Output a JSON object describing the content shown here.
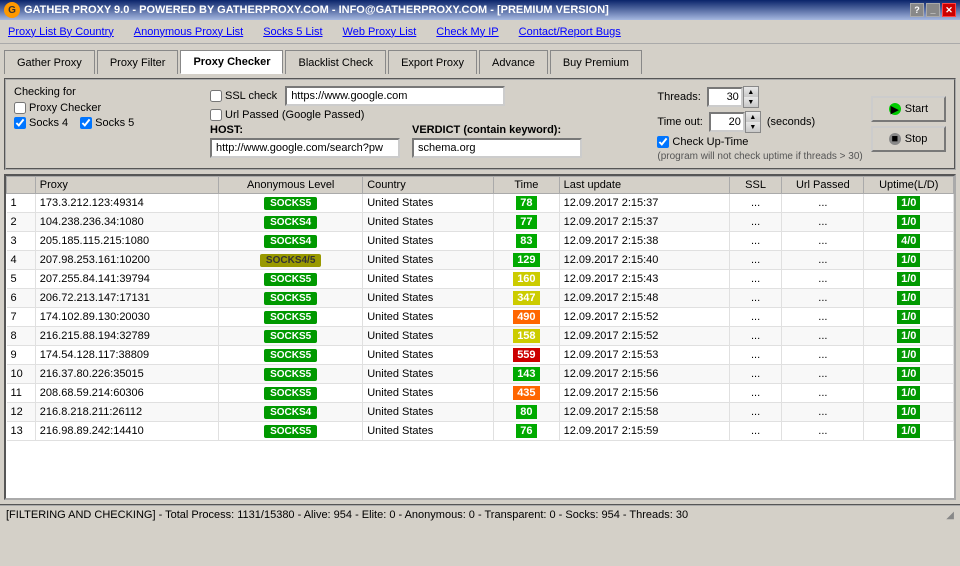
{
  "titlebar": {
    "logo": "G",
    "title": "GATHER PROXY 9.0 - POWERED BY GATHERPROXY.COM - INFO@GATHERPROXY.COM - [PREMIUM VERSION]",
    "help_btn": "?",
    "min_btn": "_",
    "close_btn": "✕"
  },
  "menubar": {
    "items": [
      {
        "id": "proxy-list-by-country",
        "label": "Proxy List By Country"
      },
      {
        "id": "anonymous-proxy-list",
        "label": "Anonymous Proxy List"
      },
      {
        "id": "socks5-list",
        "label": "Socks 5 List"
      },
      {
        "id": "web-proxy-list",
        "label": "Web Proxy List"
      },
      {
        "id": "check-my-ip",
        "label": "Check My IP"
      },
      {
        "id": "contact-report-bugs",
        "label": "Contact/Report Bugs"
      }
    ]
  },
  "tabs": [
    {
      "id": "gather-proxy",
      "label": "Gather Proxy",
      "active": false
    },
    {
      "id": "proxy-filter",
      "label": "Proxy Filter",
      "active": false
    },
    {
      "id": "proxy-checker",
      "label": "Proxy Checker",
      "active": true
    },
    {
      "id": "blacklist-check",
      "label": "Blacklist Check",
      "active": false
    },
    {
      "id": "export-proxy",
      "label": "Export Proxy",
      "active": false
    },
    {
      "id": "advance",
      "label": "Advance",
      "active": false
    },
    {
      "id": "buy-premium",
      "label": "Buy Premium",
      "active": false
    }
  ],
  "checking_panel": {
    "title": "Checking for",
    "proxy_checker_label": "Proxy Checker",
    "proxy_checker_checked": false,
    "socks4_label": "Socks 4",
    "socks4_checked": true,
    "socks5_label": "Socks 5",
    "socks5_checked": true,
    "ssl_check_label": "SSL check",
    "ssl_check_checked": false,
    "ssl_check_url": "https://www.google.com",
    "url_passed_label": "Url Passed (Google Passed)",
    "url_passed_checked": false,
    "host_label": "HOST:",
    "host_value": "http://www.google.com/search?pw",
    "verdict_label": "VERDICT (contain keyword):",
    "verdict_value": "schema.org",
    "threads_label": "Threads:",
    "threads_value": "30",
    "timeout_label": "Time out:",
    "timeout_value": "20",
    "timeout_unit": "(seconds)",
    "check_uptime_label": "Check Up-Time",
    "check_uptime_checked": true,
    "check_uptime_note": "(program will not check uptime if threads > 30)",
    "start_label": "Start",
    "stop_label": "Stop"
  },
  "table": {
    "columns": [
      "",
      "Proxy",
      "Anonymous Level",
      "Country",
      "Time",
      "Last update",
      "SSL",
      "Url Passed",
      "Uptime(L/D)"
    ],
    "rows": [
      {
        "num": "1",
        "proxy": "173.3.212.123:49314",
        "anon": "SOCKS5",
        "anon_class": "socks5",
        "country": "United States",
        "time": "78",
        "time_class": "time-green",
        "update": "12.09.2017 2:15:37",
        "ssl": "...",
        "url": "...",
        "uptime": "1/0",
        "uptime_class": "uptime-badge"
      },
      {
        "num": "2",
        "proxy": "104.238.236.34:1080",
        "anon": "SOCKS4",
        "anon_class": "socks4",
        "country": "United States",
        "time": "77",
        "time_class": "time-green",
        "update": "12.09.2017 2:15:37",
        "ssl": "...",
        "url": "...",
        "uptime": "1/0",
        "uptime_class": "uptime-badge"
      },
      {
        "num": "3",
        "proxy": "205.185.115.215:1080",
        "anon": "SOCKS4",
        "anon_class": "socks4",
        "country": "United States",
        "time": "83",
        "time_class": "time-green",
        "update": "12.09.2017 2:15:38",
        "ssl": "...",
        "url": "...",
        "uptime": "4/0",
        "uptime_class": "uptime-badge"
      },
      {
        "num": "4",
        "proxy": "207.98.253.161:10200",
        "anon": "SOCKS4/5",
        "anon_class": "socks45",
        "country": "United States",
        "time": "129",
        "time_class": "time-green",
        "update": "12.09.2017 2:15:40",
        "ssl": "...",
        "url": "...",
        "uptime": "1/0",
        "uptime_class": "uptime-badge"
      },
      {
        "num": "5",
        "proxy": "207.255.84.141:39794",
        "anon": "SOCKS5",
        "anon_class": "socks5",
        "country": "United States",
        "time": "160",
        "time_class": "time-yellow",
        "update": "12.09.2017 2:15:43",
        "ssl": "...",
        "url": "...",
        "uptime": "1/0",
        "uptime_class": "uptime-badge"
      },
      {
        "num": "6",
        "proxy": "206.72.213.147:17131",
        "anon": "SOCKS5",
        "anon_class": "socks5",
        "country": "United States",
        "time": "347",
        "time_class": "time-yellow",
        "update": "12.09.2017 2:15:48",
        "ssl": "...",
        "url": "...",
        "uptime": "1/0",
        "uptime_class": "uptime-badge"
      },
      {
        "num": "7",
        "proxy": "174.102.89.130:20030",
        "anon": "SOCKS5",
        "anon_class": "socks5",
        "country": "United States",
        "time": "490",
        "time_class": "time-orange",
        "update": "12.09.2017 2:15:52",
        "ssl": "...",
        "url": "...",
        "uptime": "1/0",
        "uptime_class": "uptime-badge"
      },
      {
        "num": "8",
        "proxy": "216.215.88.194:32789",
        "anon": "SOCKS5",
        "anon_class": "socks5",
        "country": "United States",
        "time": "158",
        "time_class": "time-yellow",
        "update": "12.09.2017 2:15:52",
        "ssl": "...",
        "url": "...",
        "uptime": "1/0",
        "uptime_class": "uptime-badge"
      },
      {
        "num": "9",
        "proxy": "174.54.128.117:38809",
        "anon": "SOCKS5",
        "anon_class": "socks5",
        "country": "United States",
        "time": "559",
        "time_class": "time-red",
        "update": "12.09.2017 2:15:53",
        "ssl": "...",
        "url": "...",
        "uptime": "1/0",
        "uptime_class": "uptime-badge"
      },
      {
        "num": "10",
        "proxy": "216.37.80.226:35015",
        "anon": "SOCKS5",
        "anon_class": "socks5",
        "country": "United States",
        "time": "143",
        "time_class": "time-green",
        "update": "12.09.2017 2:15:56",
        "ssl": "...",
        "url": "...",
        "uptime": "1/0",
        "uptime_class": "uptime-badge"
      },
      {
        "num": "11",
        "proxy": "208.68.59.214:60306",
        "anon": "SOCKS5",
        "anon_class": "socks5",
        "country": "United States",
        "time": "435",
        "time_class": "time-orange",
        "update": "12.09.2017 2:15:56",
        "ssl": "...",
        "url": "...",
        "uptime": "1/0",
        "uptime_class": "uptime-badge"
      },
      {
        "num": "12",
        "proxy": "216.8.218.211:26112",
        "anon": "SOCKS4",
        "anon_class": "socks4",
        "country": "United States",
        "time": "80",
        "time_class": "time-green",
        "update": "12.09.2017 2:15:58",
        "ssl": "...",
        "url": "...",
        "uptime": "1/0",
        "uptime_class": "uptime-badge"
      },
      {
        "num": "13",
        "proxy": "216.98.89.242:14410",
        "anon": "SOCKS5",
        "anon_class": "socks5",
        "country": "United States",
        "time": "76",
        "time_class": "time-green",
        "update": "12.09.2017 2:15:59",
        "ssl": "...",
        "url": "...",
        "uptime": "1/0",
        "uptime_class": "uptime-badge"
      }
    ]
  },
  "statusbar": {
    "text": "[FILTERING AND CHECKING] - Total Process: 1131/15380 - Alive: 954 - Elite: 0 - Anonymous: 0 - Transparent: 0 - Socks: 954 - Threads: 30",
    "resize": "◢"
  }
}
